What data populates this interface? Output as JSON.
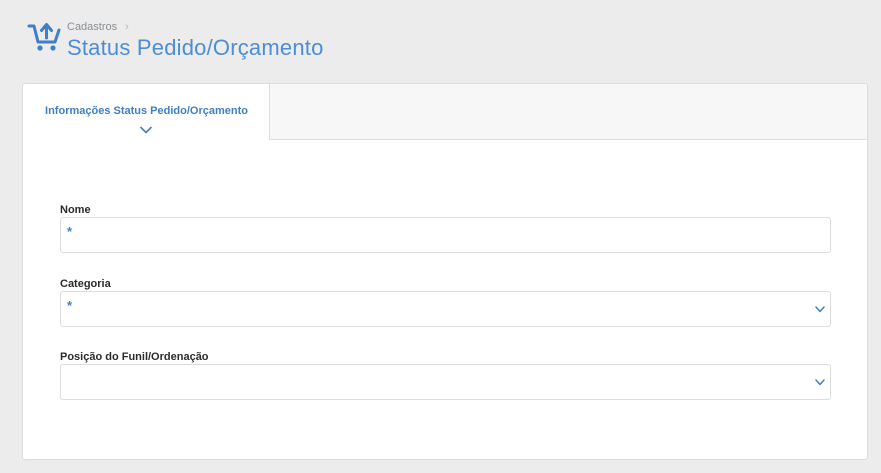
{
  "header": {
    "breadcrumb": "Cadastros",
    "breadcrumb_separator": "›",
    "title": "Status Pedido/Orçamento",
    "icon": "cart-upload-icon",
    "accent": "#4d8dd6"
  },
  "tabs": [
    {
      "label": "Informações Status Pedido/Orçamento",
      "active": true
    }
  ],
  "form": {
    "nome": {
      "label": "Nome",
      "value": "",
      "required_marker": "*"
    },
    "categoria": {
      "label": "Categoria",
      "selected": "",
      "required_marker": "*"
    },
    "posicao": {
      "label": "Posição do Funil/Ordenação",
      "selected": ""
    }
  }
}
